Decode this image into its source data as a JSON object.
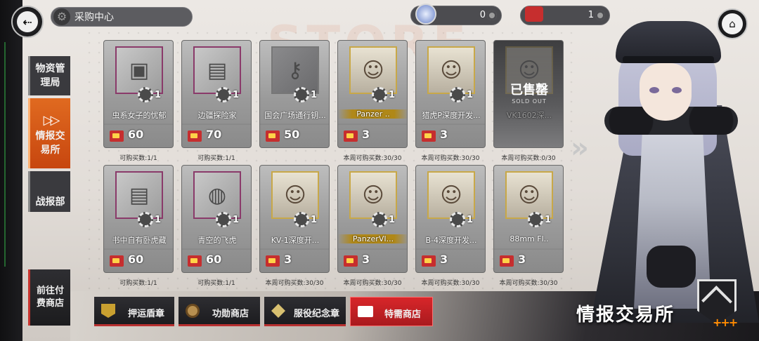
{
  "header": {
    "title": "采购中心",
    "currency_a": {
      "value": "0",
      "icon": "gem-icon",
      "color": "#b8c8f0"
    },
    "currency_b": {
      "value": "1",
      "icon": "ticket-icon",
      "color": "#c62e2e"
    }
  },
  "background_text": "STORE",
  "nav": {
    "items": [
      {
        "label": "物资管理局",
        "active": false
      },
      {
        "label": "情报交易所",
        "active": true
      },
      {
        "label": "战报部",
        "active": false
      }
    ],
    "pay_store": "前往付费商店"
  },
  "cards": [
    {
      "name": "虫系女子的忧郁",
      "qty": "1",
      "price": "60",
      "limit": "可购买数:1/1",
      "icon": "crate-icon",
      "type": "item"
    },
    {
      "name": "边疆探险家",
      "qty": "1",
      "price": "70",
      "limit": "可购买数:1/1",
      "icon": "box-icon",
      "type": "item"
    },
    {
      "name": "国会广场通行钥...",
      "qty": "1",
      "price": "50",
      "limit": "",
      "icon": "key-icon",
      "type": "plain"
    },
    {
      "name": "Panzer ..",
      "qty": "1",
      "price": "3",
      "limit": "本周可购买数:30/30",
      "icon": "portrait-icon",
      "type": "chara"
    },
    {
      "name": "猎虎P深度开发...",
      "qty": "1",
      "price": "3",
      "limit": "本周可购买数:30/30",
      "icon": "portrait-icon",
      "type": "chara"
    },
    {
      "name": "VK1602深...",
      "qty": "",
      "price": "",
      "limit": "本周可购买数:0/30",
      "icon": "portrait-icon",
      "type": "soldout",
      "soldout": "已售罄",
      "soldout_sub": "SOLD OUT"
    },
    {
      "name": "书中自有卧虎藏",
      "qty": "1",
      "price": "60",
      "limit": "可购买数:1/1",
      "icon": "box-icon",
      "type": "item"
    },
    {
      "name": "青空的飞虎",
      "qty": "1",
      "price": "60",
      "limit": "可购买数:1/1",
      "icon": "capsule-icon",
      "type": "item"
    },
    {
      "name": "KV-1深度开...",
      "qty": "1",
      "price": "3",
      "limit": "本周可购买数:30/30",
      "icon": "portrait-icon",
      "type": "chara"
    },
    {
      "name": "PanzerVI...",
      "qty": "1",
      "price": "3",
      "limit": "本周可购买数:30/30",
      "icon": "portrait-icon",
      "type": "chara"
    },
    {
      "name": "B-4深度开发...",
      "qty": "1",
      "price": "3",
      "limit": "本周可购买数:30/30",
      "icon": "portrait-icon",
      "type": "chara"
    },
    {
      "name": "88mm Fl..",
      "qty": "1",
      "price": "3",
      "limit": "本周可购买数:30/30",
      "icon": "portrait-icon",
      "type": "chara"
    }
  ],
  "tabs": [
    {
      "label": "押运盾章",
      "icon": "shield-badge-icon",
      "active": false
    },
    {
      "label": "功勋商店",
      "icon": "medal-icon",
      "active": false
    },
    {
      "label": "服役纪念章",
      "icon": "star-badge-icon",
      "active": false
    },
    {
      "label": "特需商店",
      "icon": "ticket-icon",
      "active": true
    }
  ],
  "section_title": "情报交易所",
  "colors": {
    "accent": "#e06a20",
    "red": "#c62e2e",
    "gold": "#b08818"
  }
}
